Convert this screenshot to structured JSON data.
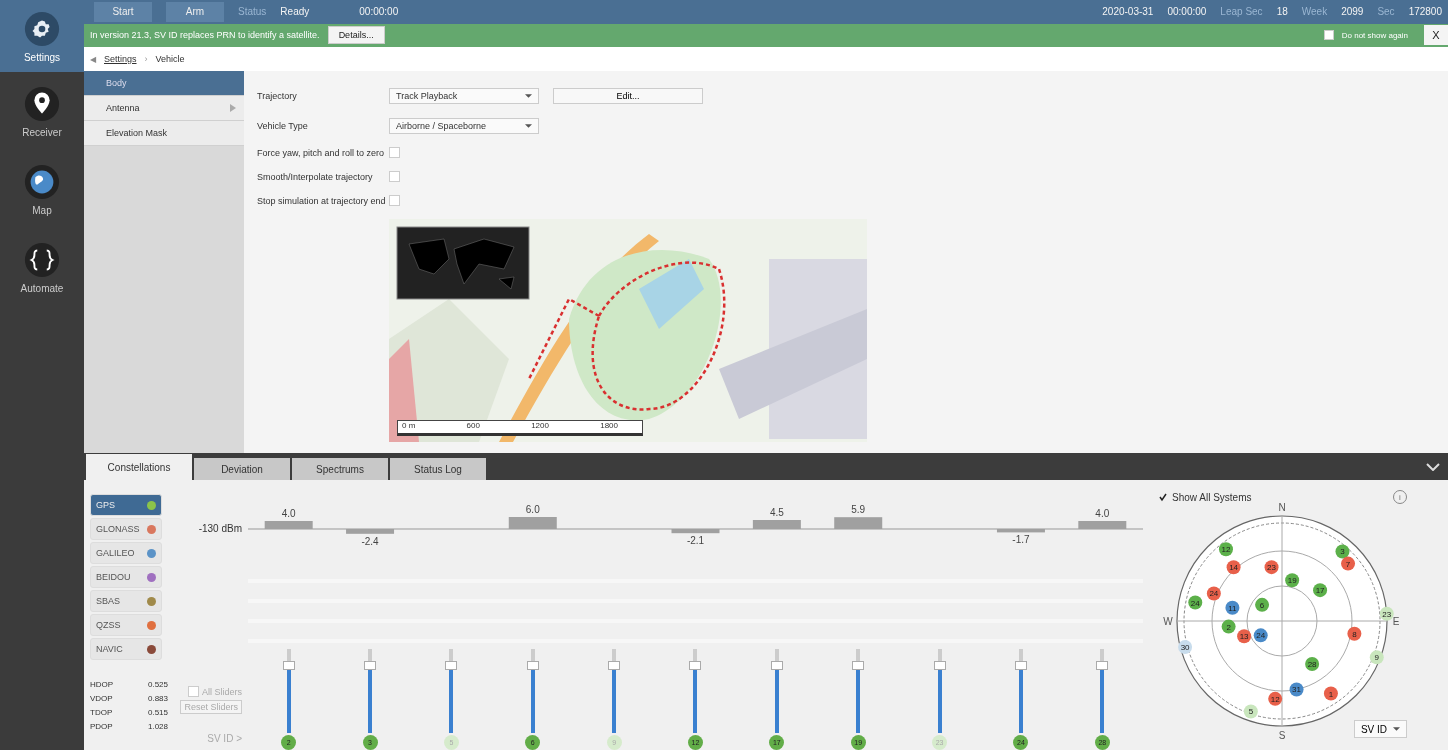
{
  "sidebar": {
    "items": [
      {
        "label": "Settings",
        "selected": true
      },
      {
        "label": "Receiver",
        "selected": false
      },
      {
        "label": "Map",
        "selected": false
      },
      {
        "label": "Automate",
        "selected": false
      }
    ]
  },
  "top_bar": {
    "buttons": [
      "Start",
      "Arm"
    ],
    "status_label": "Status",
    "status": "Ready",
    "elapsed": "00:00:00",
    "date": "2020-03-31",
    "time": "00:00:00",
    "fields": [
      {
        "label": "Leap Sec",
        "value": "18"
      },
      {
        "label": "Week",
        "value": "2099"
      },
      {
        "label": "Sec",
        "value": "172800"
      }
    ]
  },
  "banner": {
    "message": "In version 21.3, SV ID replaces PRN to identify a satellite.",
    "button": "Details...",
    "checkbox": {
      "label": "Do not show again",
      "checked": false
    },
    "close": "X"
  },
  "breadcrumb": {
    "back": "◀",
    "items": [
      "Settings",
      "Vehicle"
    ],
    "separator": "›"
  },
  "subnav": [
    {
      "label": "Body",
      "selected": true,
      "has_children": false
    },
    {
      "label": "Antenna",
      "selected": false,
      "has_children": true
    },
    {
      "label": "Elevation Mask",
      "selected": false,
      "has_children": false
    }
  ],
  "form": {
    "trajectory": {
      "label": "Trajectory",
      "value": "Track Playback",
      "button": "Edit..."
    },
    "vehicle_type": {
      "label": "Vehicle Type",
      "value": "Airborne / Spaceborne"
    },
    "checkboxes": [
      {
        "label": "Force yaw, pitch and roll to zero",
        "checked": false
      },
      {
        "label": "Smooth/Interpolate trajectory",
        "checked": false
      },
      {
        "label": "Stop simulation at trajectory end",
        "checked": false
      }
    ]
  },
  "map": {
    "kind": "picture",
    "scale_labels": [
      "0 m",
      "600",
      "1200",
      "1800"
    ]
  },
  "bottom_tabs": [
    {
      "label": "Constellations",
      "selected": true
    },
    {
      "label": "Deviation",
      "selected": false
    },
    {
      "label": "Spectrums",
      "selected": false
    },
    {
      "label": "Status Log",
      "selected": false
    }
  ],
  "constellations": [
    {
      "label": "GPS",
      "color": "#8bc34a",
      "selected": true
    },
    {
      "label": "GLONASS",
      "color": "#d9775e",
      "selected": false
    },
    {
      "label": "GALILEO",
      "color": "#5b93c7",
      "selected": false
    },
    {
      "label": "BEIDOU",
      "color": "#a070c0",
      "selected": false
    },
    {
      "label": "SBAS",
      "color": "#a08a4a",
      "selected": false
    },
    {
      "label": "QZSS",
      "color": "#e07040",
      "selected": false
    },
    {
      "label": "NAVIC",
      "color": "#8a4a3a",
      "selected": false
    }
  ],
  "dop": [
    {
      "label": "HDOP",
      "value": "0.525"
    },
    {
      "label": "VDOP",
      "value": "0.883"
    },
    {
      "label": "TDOP",
      "value": "0.515"
    },
    {
      "label": "PDOP",
      "value": "1.028"
    }
  ],
  "power": {
    "reference_label": "-130 dBm",
    "chart_data": {
      "type": "bar",
      "categories": [
        "2",
        "3",
        "5",
        "6",
        "9",
        "12",
        "17",
        "19",
        "23",
        "24",
        "28"
      ],
      "values": [
        4.0,
        -2.4,
        null,
        6.0,
        null,
        -2.1,
        4.5,
        5.9,
        null,
        -1.7,
        4.0
      ],
      "value_labels": [
        "4.0",
        "-2.4",
        null,
        "6.0",
        null,
        "-2.1",
        "4.5",
        "5.9",
        null,
        "-1.7",
        "4.0"
      ]
    }
  },
  "sliders": {
    "all_sliders": {
      "label": "All Sliders",
      "checked": false
    },
    "reset": "Reset Sliders",
    "sv_label": "SV ID >",
    "channels": [
      {
        "level": 0.8,
        "dimmed": false
      },
      {
        "level": 0.8,
        "dimmed": false
      },
      {
        "level": 0.8,
        "dimmed": true
      },
      {
        "level": 0.8,
        "dimmed": false
      },
      {
        "level": 0.8,
        "dimmed": true
      },
      {
        "level": 0.8,
        "dimmed": false
      },
      {
        "level": 0.8,
        "dimmed": false
      },
      {
        "level": 0.8,
        "dimmed": false
      },
      {
        "level": 0.8,
        "dimmed": true
      },
      {
        "level": 0.8,
        "dimmed": false
      },
      {
        "level": 0.8,
        "dimmed": false
      }
    ]
  },
  "sky_plot": {
    "show_all": {
      "label": "Show All Systems",
      "checked": true
    },
    "info": "i",
    "compass": [
      "N",
      "E",
      "S",
      "W"
    ],
    "sort": "SV ID",
    "satellites": [
      {
        "label": "12",
        "color": "#5cb04a"
      },
      {
        "label": "14",
        "color": "#e8604a"
      },
      {
        "label": "23",
        "color": "#e8604a"
      },
      {
        "label": "19",
        "color": "#5cb04a"
      },
      {
        "label": "17",
        "color": "#5cb04a"
      },
      {
        "label": "3",
        "color": "#5cb04a"
      },
      {
        "label": "7",
        "color": "#e8604a"
      },
      {
        "label": "24",
        "color": "#e8604a"
      },
      {
        "label": "24",
        "color": "#5cb04a"
      },
      {
        "label": "11",
        "color": "#4a8ac8"
      },
      {
        "label": "6",
        "color": "#5cb04a"
      },
      {
        "label": "23",
        "color": "#c9e6bd"
      },
      {
        "label": "2",
        "color": "#5cb04a"
      },
      {
        "label": "13",
        "color": "#e8604a"
      },
      {
        "label": "24",
        "color": "#4a8ac8"
      },
      {
        "label": "8",
        "color": "#e8604a"
      },
      {
        "label": "30",
        "color": "#c8dcec"
      },
      {
        "label": "9",
        "color": "#c9e6bd"
      },
      {
        "label": "28",
        "color": "#5cb04a"
      },
      {
        "label": "31",
        "color": "#4a8ac8"
      },
      {
        "label": "1",
        "color": "#e8604a"
      },
      {
        "label": "12",
        "color": "#e8604a"
      },
      {
        "label": "5",
        "color": "#c9e6bd"
      }
    ]
  }
}
